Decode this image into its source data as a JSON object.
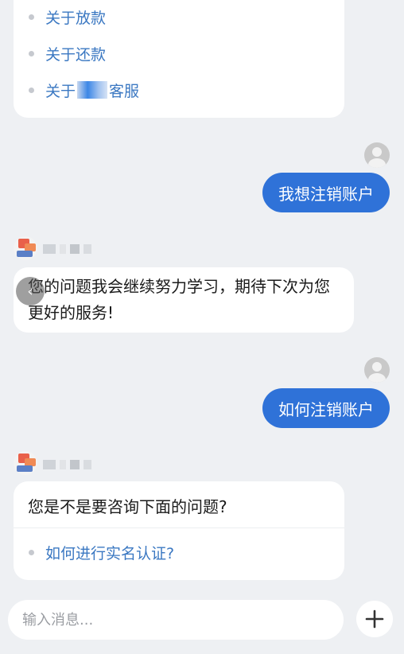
{
  "faq_card": {
    "items": [
      {
        "label": "关于放款"
      },
      {
        "label": "关于还款"
      },
      {
        "label_prefix": "关于",
        "label_suffix": "客服"
      }
    ]
  },
  "messages": [
    {
      "from": "user",
      "text": "我想注销账户"
    },
    {
      "from": "bot",
      "text": "您的问题我会继续努力学习，期待下次为您更好的服务!"
    },
    {
      "from": "user",
      "text": "如何注销账户"
    },
    {
      "from": "bot",
      "text": "您是不是要咨询下面的问题?",
      "links": [
        "如何进行实名认证?"
      ]
    }
  ],
  "back_icon": "chevron-left-icon",
  "composer": {
    "placeholder": "输入消息...",
    "plus_icon": "plus-icon"
  },
  "colors": {
    "accent": "#2f72d8",
    "link": "#3b78c2",
    "background": "#eef0f3"
  }
}
